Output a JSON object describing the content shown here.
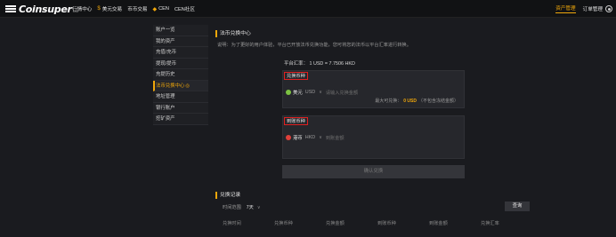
{
  "topbar": {
    "logo_text": "Coinsuper",
    "logo_sub": "RM",
    "nav": [
      {
        "label": "行情中心",
        "icon": ""
      },
      {
        "label": "美元交易",
        "icon": "$"
      },
      {
        "label": "币币交易",
        "icon": ""
      },
      {
        "label": "CEN",
        "icon": "◆"
      },
      {
        "label": "CEN社区",
        "icon": ""
      }
    ],
    "asset_label": "资产管理",
    "order_label": "订单管理"
  },
  "sidebar": {
    "items": [
      {
        "label": "账户一览",
        "active": false
      },
      {
        "label": "我的资产",
        "active": false
      },
      {
        "label": "充值/充币",
        "active": false
      },
      {
        "label": "提现/提币",
        "active": false
      },
      {
        "label": "充提历史",
        "active": false
      },
      {
        "label": "法币兑换中心",
        "active": true,
        "badge": "◎"
      },
      {
        "label": "地址管理",
        "active": false
      },
      {
        "label": "银行账户",
        "active": false
      },
      {
        "label": "挖矿资产",
        "active": false
      }
    ]
  },
  "main": {
    "title": "法币兑换中心",
    "description": "说明：为了更好的用户体验，平台已开放法币兑换功能，您可将您的法币以平台汇率进行转换。",
    "rate_text": "平台汇率： 1 USD = 7.7506 HKD",
    "from": {
      "label": "兑换币种",
      "currency_cn": "美元",
      "currency_code": "USD",
      "amount_placeholder": "请输入兑换金额",
      "max_label": "最大可兑换：",
      "max_value": "0 USD",
      "max_note": "（不包含冻结金额）"
    },
    "to": {
      "label": "到账币种",
      "currency_cn": "港币",
      "currency_code": "HKD",
      "amount_placeholder": "到账金额"
    },
    "confirm_label": "确认兑换"
  },
  "history": {
    "title": "兑换记录",
    "filter_label": "时间范围",
    "filter_value": "7天",
    "query_label": "查询",
    "columns": [
      "兑换时间",
      "兑换币种",
      "兑换金额",
      "到账币种",
      "到账金额",
      "兑换汇率"
    ]
  },
  "colors": {
    "accent": "#f0a70a",
    "highlight_box": "#e02020",
    "background": "#1a1b1f"
  }
}
